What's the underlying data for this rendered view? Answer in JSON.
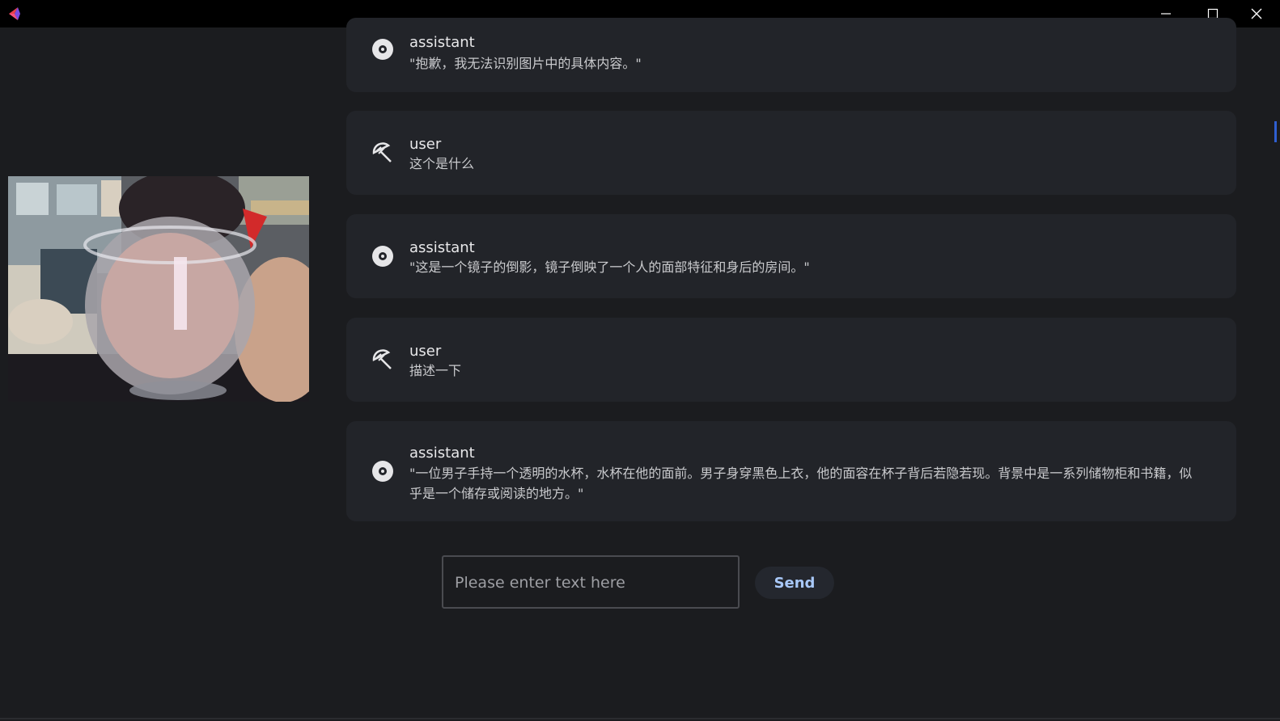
{
  "window": {
    "icons": {
      "logo": "app-logo-icon",
      "minimize": "minimize-icon",
      "maximize": "maximize-icon",
      "close": "close-icon"
    }
  },
  "camera": {
    "description_icon": "camera-feed"
  },
  "messages": [
    {
      "role": "assistant",
      "content": "\"抱歉，我无法识别图片中的具体内容。\"",
      "icon": "disc-icon"
    },
    {
      "role": "user",
      "content": "这个是什么",
      "icon": "umbrella-icon"
    },
    {
      "role": "assistant",
      "content": "\"这是一个镜子的倒影，镜子倒映了一个人的面部特征和身后的房间。\"",
      "icon": "disc-icon"
    },
    {
      "role": "user",
      "content": "描述一下",
      "icon": "umbrella-icon"
    },
    {
      "role": "assistant",
      "content": "\"一位男子手持一个透明的水杯，水杯在他的面前。男子身穿黑色上衣，他的面容在杯子背后若隐若现。背景中是一系列储物柜和书籍，似乎是一个储存或阅读的地方。\"",
      "icon": "disc-icon"
    }
  ],
  "composer": {
    "placeholder": "Please enter text here",
    "value": "",
    "send_label": "Send"
  },
  "colors": {
    "background": "#1b1c1f",
    "card": "#222429",
    "titlebar": "#000000",
    "accent": "#a8c8f8",
    "logo": "#e8404c"
  }
}
